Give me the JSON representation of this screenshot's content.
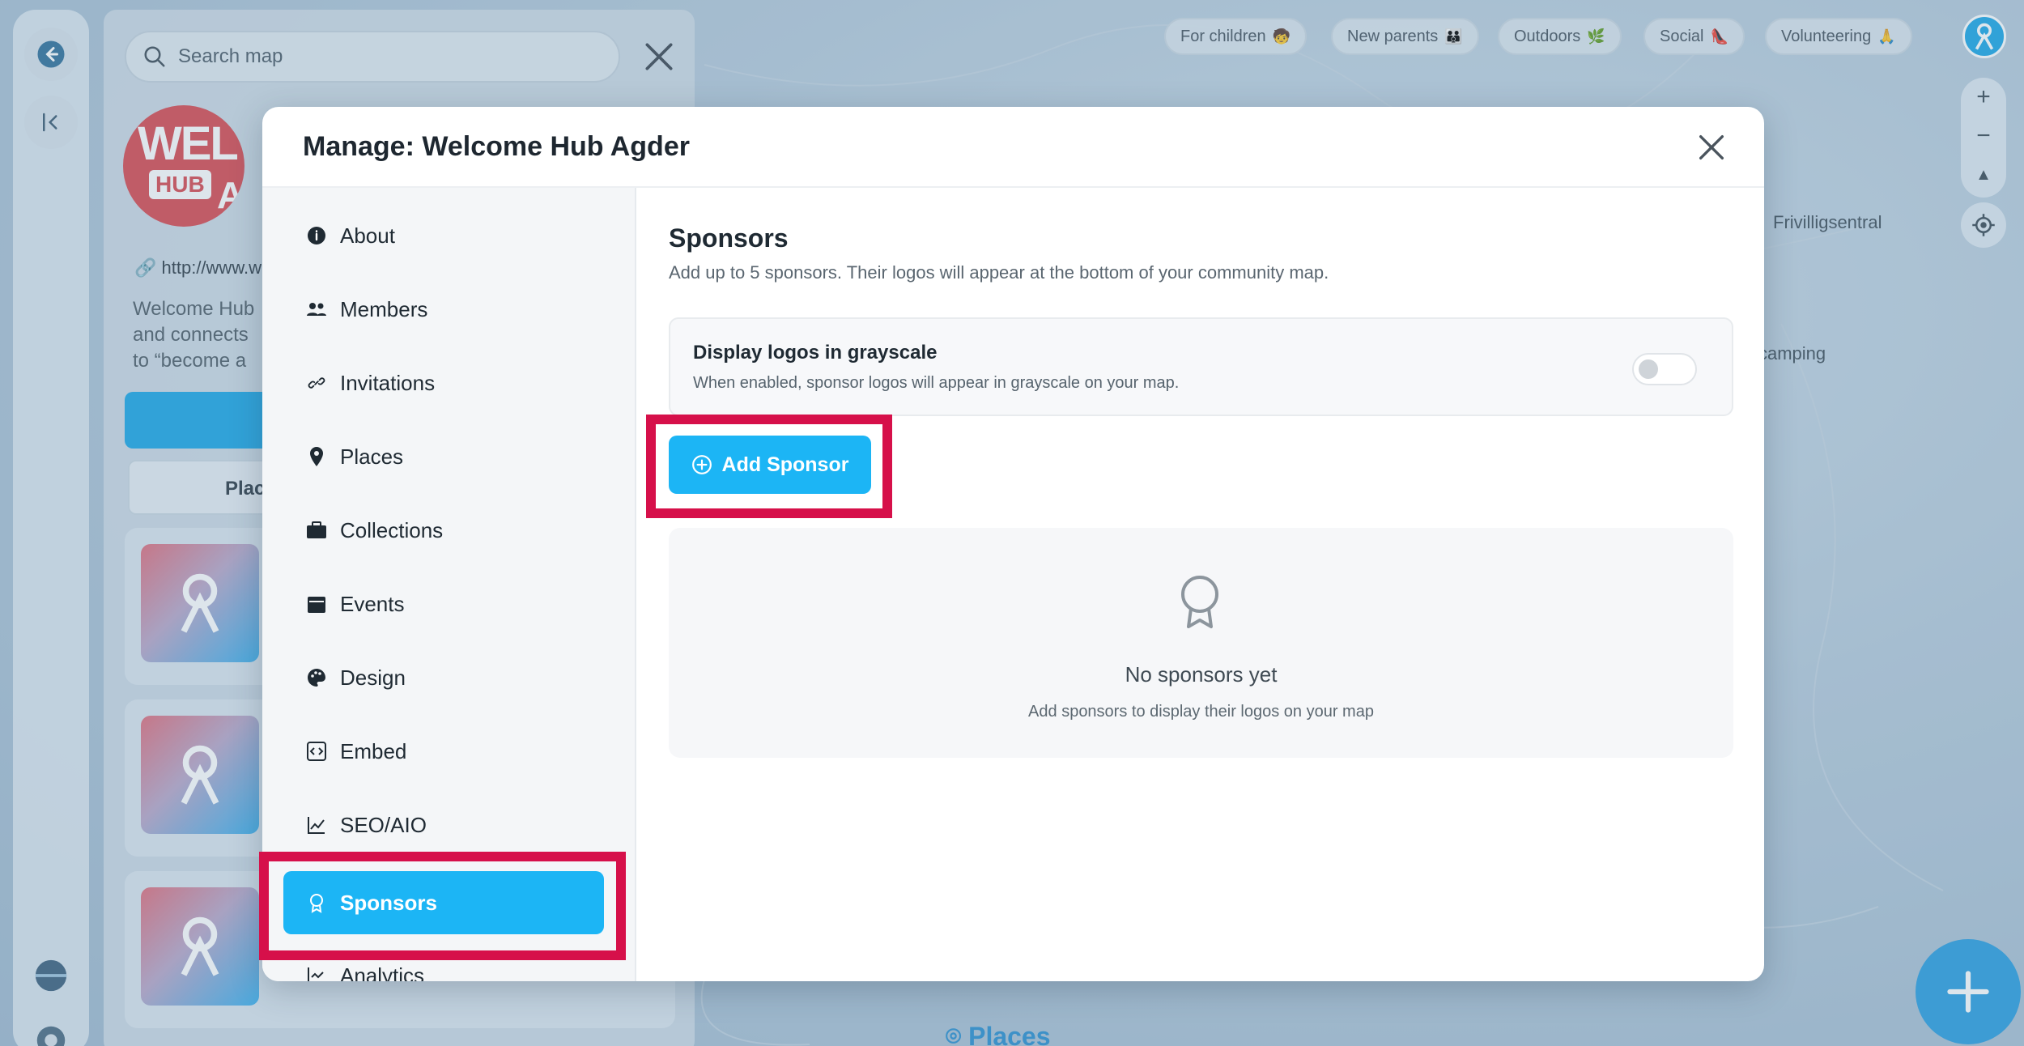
{
  "map": {
    "search_placeholder": "Search map",
    "chips": [
      {
        "label": "For children",
        "emoji": "🧒"
      },
      {
        "label": "New parents",
        "emoji": "👪"
      },
      {
        "label": "Outdoors",
        "emoji": "🌿"
      },
      {
        "label": "Social",
        "emoji": "👠"
      },
      {
        "label": "Volunteering",
        "emoji": "🙏"
      }
    ],
    "labels": {
      "frivilligsentral": "Frivilligsentral",
      "camping": "camping",
      "places": "Places"
    },
    "zoom": {
      "in": "+",
      "out": "−",
      "north": "▲"
    }
  },
  "sidebar_panel": {
    "logo": {
      "line1": "WEL",
      "line2": "HUB",
      "line3": "A"
    },
    "link": "http://www.w",
    "description": [
      "Welcome Hub",
      "and connects",
      "to “become a"
    ],
    "tab_label": "Plac"
  },
  "dialog": {
    "title": "Manage: Welcome Hub Agder",
    "nav": [
      {
        "label": "About",
        "icon": "info-icon"
      },
      {
        "label": "Members",
        "icon": "members-icon"
      },
      {
        "label": "Invitations",
        "icon": "link-icon"
      },
      {
        "label": "Places",
        "icon": "pin-icon"
      },
      {
        "label": "Collections",
        "icon": "briefcase-icon"
      },
      {
        "label": "Events",
        "icon": "calendar-icon"
      },
      {
        "label": "Design",
        "icon": "palette-icon"
      },
      {
        "label": "Embed",
        "icon": "code-icon"
      },
      {
        "label": "SEO/AIO",
        "icon": "chart-icon"
      },
      {
        "label": "Sponsors",
        "icon": "award-icon",
        "active": true
      },
      {
        "label": "Analytics",
        "icon": "analytics-icon"
      }
    ],
    "section": {
      "title": "Sponsors",
      "subtitle": "Add up to 5 sponsors. Their logos will appear at the bottom of your community map.",
      "grayscale": {
        "title": "Display logos in grayscale",
        "description": "When enabled, sponsor logos will appear in grayscale on your map.",
        "enabled": false
      },
      "add_button": "Add Sponsor",
      "empty": {
        "title": "No sponsors yet",
        "subtitle": "Add sponsors to display their logos on your map"
      }
    }
  },
  "colors": {
    "accent": "#1cb5f5",
    "highlight": "#d6104a",
    "fab": "#2a9ee0"
  }
}
